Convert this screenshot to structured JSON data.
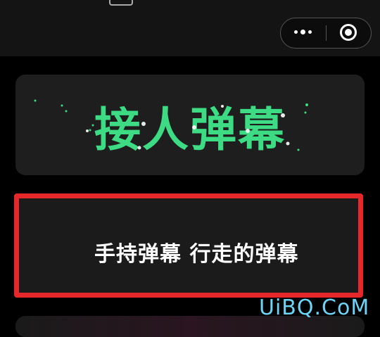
{
  "card_top": {
    "title": "接人弹幕",
    "title_color": "#3ddc84"
  },
  "card_selected": {
    "label": "手持弹幕 行走的弹幕",
    "border_color": "#e6282d"
  },
  "watermark": "UiBQ.CoM",
  "icons": {
    "more": "more-dots-icon",
    "close": "target-close-icon"
  }
}
